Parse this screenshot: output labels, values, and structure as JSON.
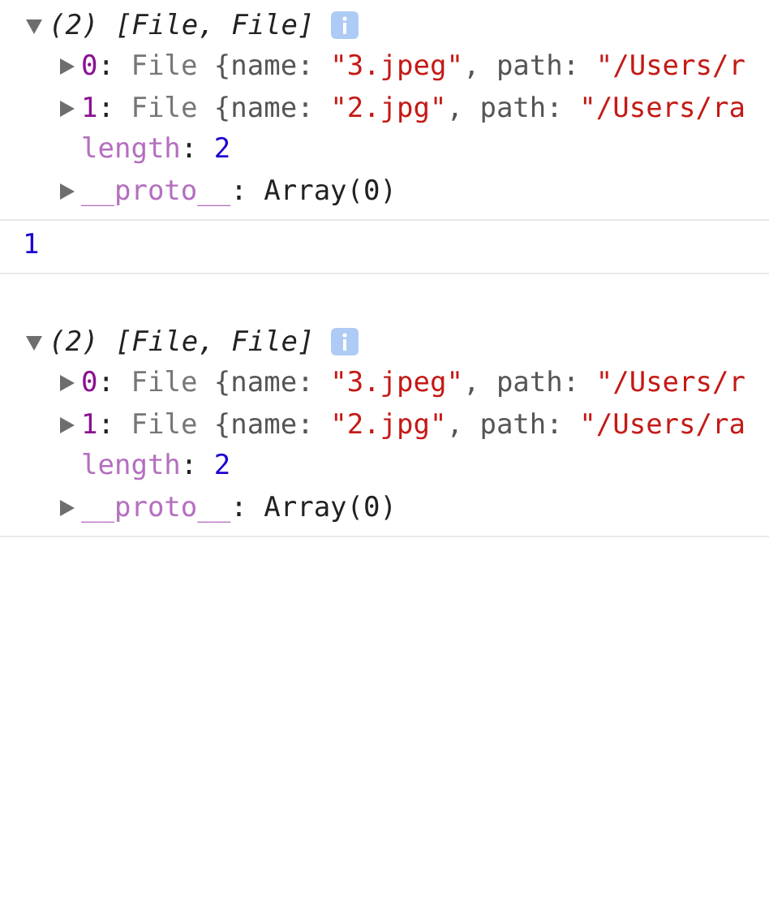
{
  "console": [
    {
      "kind": "array",
      "expanded": true,
      "summary": "(2) [File, File]",
      "properties": [
        {
          "expandable": true,
          "tokens": [
            {
              "t": "0",
              "kind": "index"
            },
            {
              "t": ": ",
              "kind": "punct"
            },
            {
              "t": "File ",
              "kind": "classname"
            },
            {
              "t": "{name: ",
              "kind": "key"
            },
            {
              "t": "\"3.jpeg\"",
              "kind": "string"
            },
            {
              "t": ", path: ",
              "kind": "key"
            },
            {
              "t": "\"/Users/r",
              "kind": "string"
            }
          ]
        },
        {
          "expandable": true,
          "tokens": [
            {
              "t": "1",
              "kind": "index"
            },
            {
              "t": ": ",
              "kind": "punct"
            },
            {
              "t": "File ",
              "kind": "classname"
            },
            {
              "t": "{name: ",
              "kind": "key"
            },
            {
              "t": "\"2.jpg\"",
              "kind": "string"
            },
            {
              "t": ", path: ",
              "kind": "key"
            },
            {
              "t": "\"/Users/ra",
              "kind": "string"
            }
          ]
        },
        {
          "expandable": false,
          "tokens": [
            {
              "t": "length",
              "kind": "dimkey"
            },
            {
              "t": ": ",
              "kind": "punct"
            },
            {
              "t": "2",
              "kind": "number"
            }
          ]
        },
        {
          "expandable": true,
          "tokens": [
            {
              "t": "__proto__",
              "kind": "dimkey"
            },
            {
              "t": ": ",
              "kind": "punct"
            },
            {
              "t": "Array(0)",
              "kind": "plain"
            }
          ]
        }
      ]
    },
    {
      "kind": "number",
      "text": "1"
    },
    {
      "kind": "array",
      "expanded": true,
      "summary": "(2) [File, File]",
      "properties": [
        {
          "expandable": true,
          "tokens": [
            {
              "t": "0",
              "kind": "index"
            },
            {
              "t": ": ",
              "kind": "punct"
            },
            {
              "t": "File ",
              "kind": "classname"
            },
            {
              "t": "{name: ",
              "kind": "key"
            },
            {
              "t": "\"3.jpeg\"",
              "kind": "string"
            },
            {
              "t": ", path: ",
              "kind": "key"
            },
            {
              "t": "\"/Users/r",
              "kind": "string"
            }
          ]
        },
        {
          "expandable": true,
          "tokens": [
            {
              "t": "1",
              "kind": "index"
            },
            {
              "t": ": ",
              "kind": "punct"
            },
            {
              "t": "File ",
              "kind": "classname"
            },
            {
              "t": "{name: ",
              "kind": "key"
            },
            {
              "t": "\"2.jpg\"",
              "kind": "string"
            },
            {
              "t": ", path: ",
              "kind": "key"
            },
            {
              "t": "\"/Users/ra",
              "kind": "string"
            }
          ]
        },
        {
          "expandable": false,
          "tokens": [
            {
              "t": "length",
              "kind": "dimkey"
            },
            {
              "t": ": ",
              "kind": "punct"
            },
            {
              "t": "2",
              "kind": "number"
            }
          ]
        },
        {
          "expandable": true,
          "tokens": [
            {
              "t": "__proto__",
              "kind": "dimkey"
            },
            {
              "t": ": ",
              "kind": "punct"
            },
            {
              "t": "Array(0)",
              "kind": "plain"
            }
          ]
        }
      ]
    }
  ]
}
